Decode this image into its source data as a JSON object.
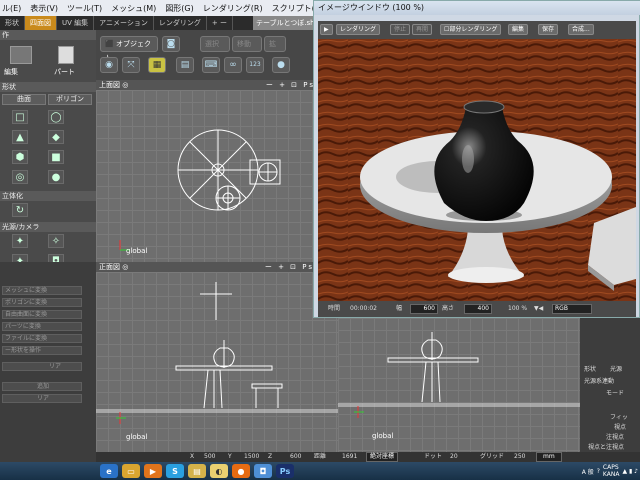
{
  "menubar": {
    "items": [
      "ル(E)",
      "表示(V)",
      "ツール(T)",
      "メッシュ(M)",
      "図形(G)",
      "レンダリング(R)",
      "スクリプト(S)"
    ]
  },
  "tabs": [
    "形状",
    "四面図",
    "UV 編集",
    "アニメーション",
    "レンダリング",
    "+ ー"
  ],
  "doc_tab": "テーブルとつぼ.shd",
  "left_panel": {
    "create_header": "作",
    "edit_label": "編集",
    "part_label": "パート",
    "shape_header": "形状",
    "curve_label": "曲面",
    "polygon_label": "ポリゴン",
    "solid_header": "立体化",
    "light_camera_header": "光源/カメラ"
  },
  "left_lower": {
    "rows": [
      "メッシュに変換",
      "ポリゴンに変換",
      "自由曲面に変換",
      "パーツに変換",
      "ファイルに変換",
      "ー形状を操作"
    ],
    "right_label": "リア",
    "button2": "追加",
    "button3": "リア"
  },
  "toolbar": {
    "object_label": "オブジェクト",
    "btn_select": "選択",
    "btn_edit": "移動",
    "btn_extra": "拡",
    "num_label": "123"
  },
  "viewports": {
    "top": {
      "title": "上面図",
      "tools": "ー + ⊡ Ps",
      "global": "global"
    },
    "front": {
      "title": "正面図",
      "tools": "ー + ⊡ Ps",
      "global": "global"
    },
    "right_global": "global"
  },
  "image_window": {
    "title": "イメージウインドウ (100 %)",
    "btn_render": "レンダリング",
    "btn_stop": "停止",
    "btn_resume": "再開",
    "partial_render": "部分レンダリング",
    "btn_edit": "編集",
    "btn_save": "保存",
    "btn_composite": "合成...",
    "time_label": "時間",
    "time_value": "00:00:02",
    "width_label": "幅",
    "width_value": "600",
    "height_label": "高さ",
    "height_value": "400",
    "zoom_value": "100 %",
    "channel_value": "RGB"
  },
  "right_panel": {
    "items": [
      "形状",
      "光源",
      "光源系連動",
      "モード",
      "フィッ",
      "視点",
      "注視点",
      "視点と注視点"
    ]
  },
  "statusbar": {
    "x_label": "X",
    "x_value": "500",
    "y_label": "Y",
    "y_value": "1500",
    "z_label": "Z",
    "z_value": "600",
    "dist_label": "距離",
    "dist_value": "1691",
    "coord_mode": "絶対座標",
    "dot_label": "ドット",
    "dot_value": "20",
    "grid_label": "グリッド",
    "grid_value": "250",
    "unit_value": "mm"
  },
  "taskbar": {
    "apps": [
      "ie",
      "explorer",
      "media",
      "skype",
      "folder",
      "shade",
      "firefox",
      "app",
      "photoshop"
    ],
    "tray_text": "A 般",
    "caps": "CAPS",
    "kana": "KANA"
  },
  "colors": {
    "accent_tab": "#c98a1c",
    "floor": "#7a3416",
    "table": "#e8e8e8",
    "vase": "#151515"
  }
}
